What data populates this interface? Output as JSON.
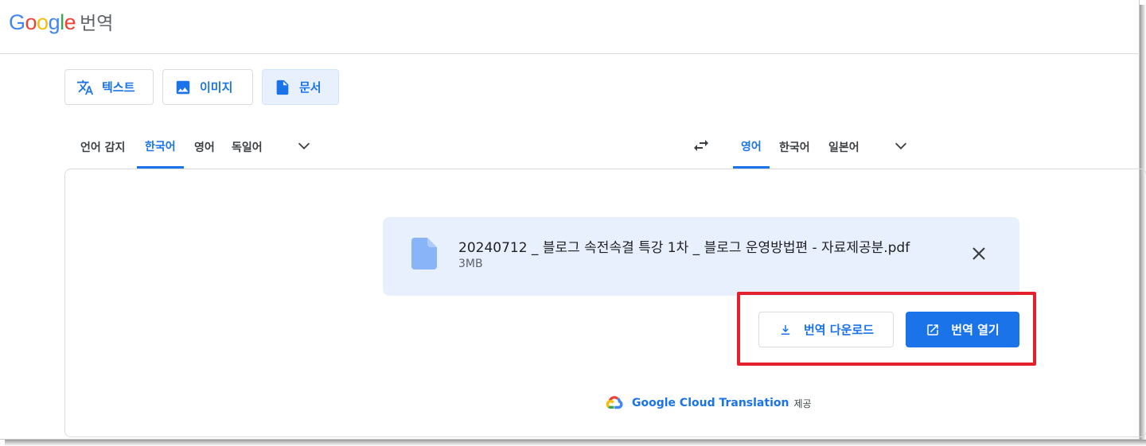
{
  "header": {
    "logo_letters": [
      "G",
      "o",
      "o",
      "g",
      "l",
      "e"
    ],
    "product_name": "번역"
  },
  "modes": [
    {
      "label": "텍스트",
      "icon": "translate-icon",
      "active": false
    },
    {
      "label": "이미지",
      "icon": "image-icon",
      "active": false
    },
    {
      "label": "문서",
      "icon": "document-icon",
      "active": true
    }
  ],
  "source_languages": [
    {
      "label": "언어 감지",
      "active": false
    },
    {
      "label": "한국어",
      "active": true
    },
    {
      "label": "영어",
      "active": false
    },
    {
      "label": "독일어",
      "active": false
    }
  ],
  "target_languages": [
    {
      "label": "영어",
      "active": true
    },
    {
      "label": "한국어",
      "active": false
    },
    {
      "label": "일본어",
      "active": false
    }
  ],
  "file": {
    "name": "20240712 _ 블로그 속전속결 특강 1차 _ 블로그 운영방법편 - 자료제공분.pdf",
    "size": "3MB"
  },
  "actions": {
    "download_label": "번역 다운로드",
    "open_label": "번역 열기"
  },
  "attribution": {
    "brand": "Google Cloud Translation",
    "suffix": "제공"
  },
  "colors": {
    "accent": "#1a73e8",
    "active_bg": "#e8f0fe",
    "highlight": "#e3202c"
  }
}
